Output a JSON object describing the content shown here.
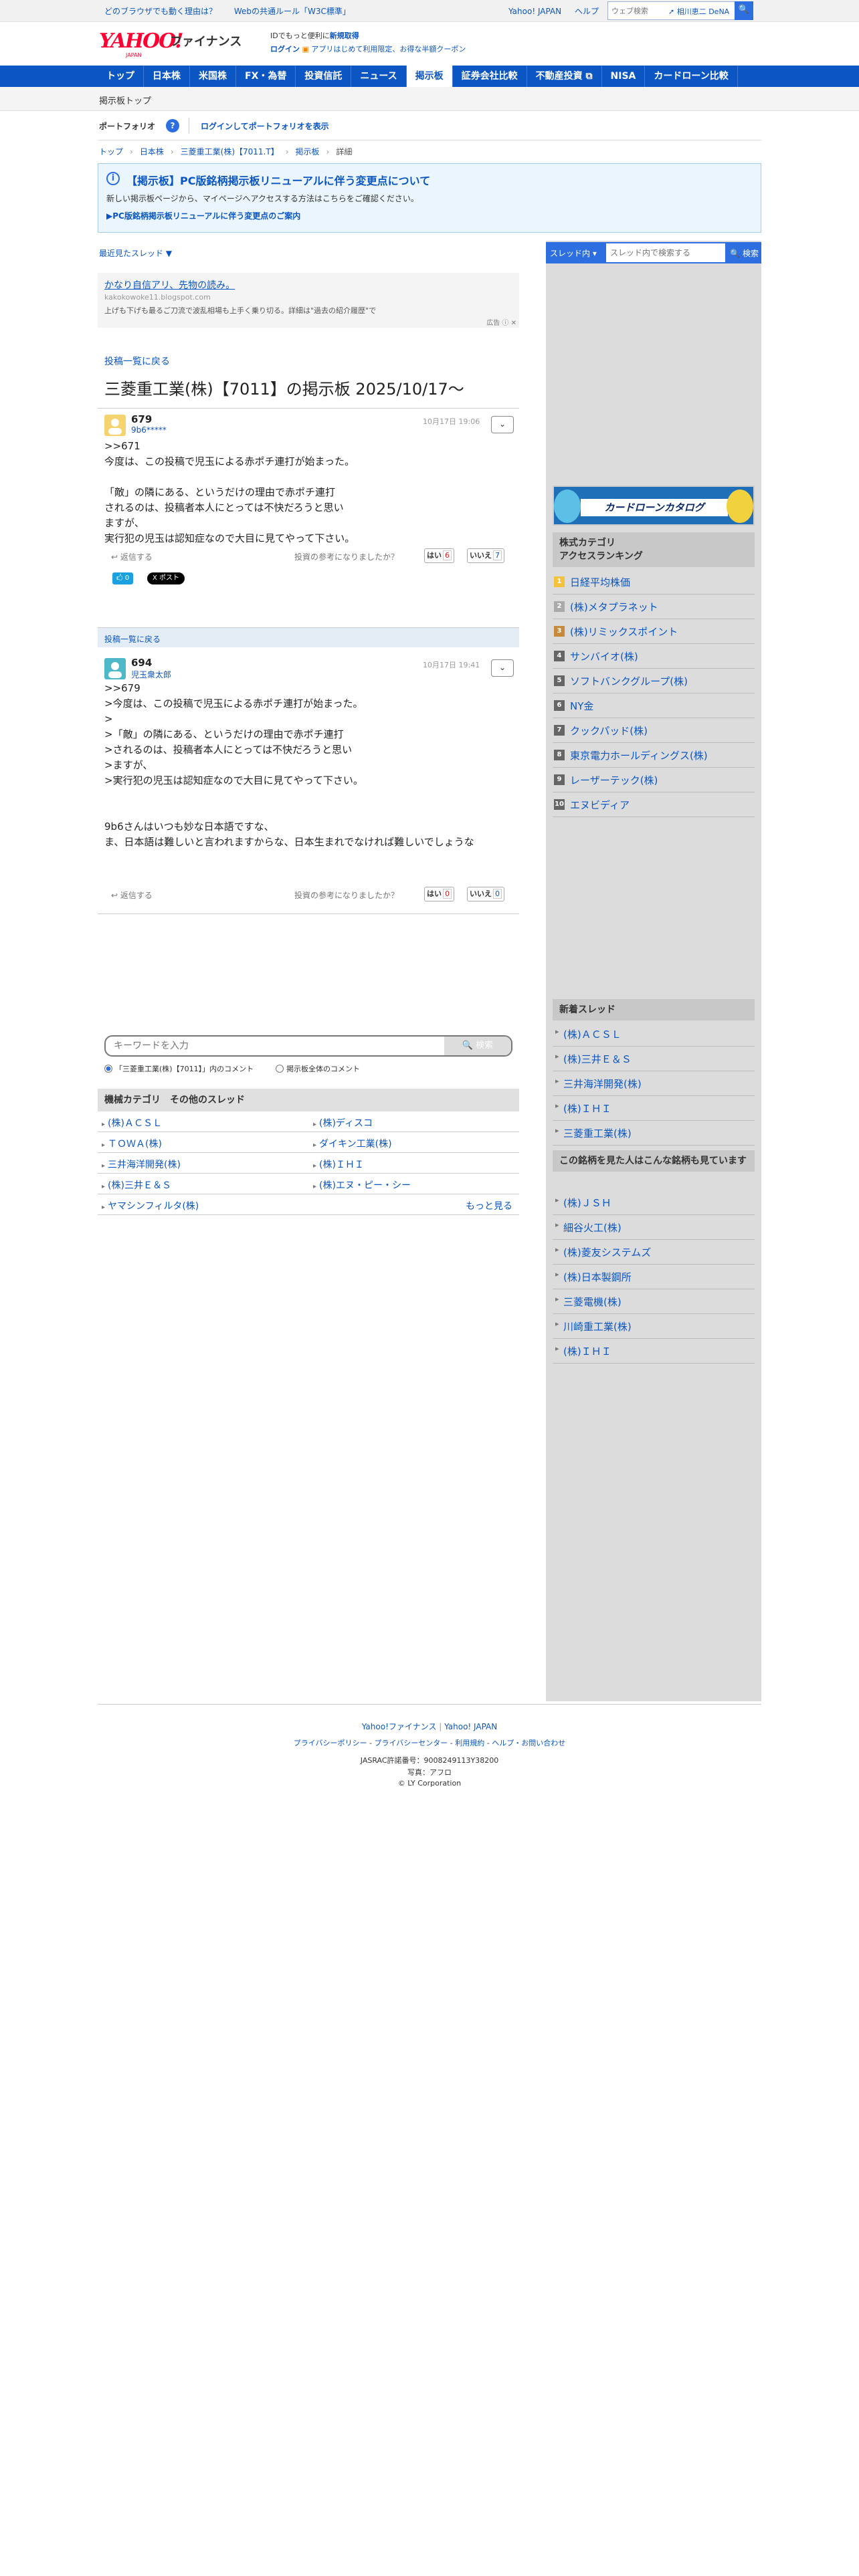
{
  "topbar": {
    "promo1": "どのブラウザでも動く理由は？",
    "promo2": "Webの共通ルール「W3C標準」",
    "yahoo_japan": "Yahoo! JAPAN",
    "help": "ヘルプ",
    "search_placeholder": "ウェブ検索",
    "user": "相川恵二 DeNA"
  },
  "header": {
    "logo": "YAHOO!",
    "logo_sub": "JAPAN",
    "service": "ファイナンス",
    "promo_line1": "IDでもっと便利に",
    "promo_signup": "新規取得",
    "login": "ログイン",
    "promo_line2": "アプリはじめて利用限定、お得な半額クーポン"
  },
  "nav": {
    "items": [
      "トップ",
      "日本株",
      "米国株",
      "FX・為替",
      "投資信託",
      "ニュース",
      "掲示板",
      "証券会社比較",
      "不動産投資",
      "NISA",
      "カードローン比較"
    ],
    "active": "掲示板"
  },
  "subnav": {
    "label": "掲示板トップ"
  },
  "portfolio": {
    "title": "ポートフォリオ",
    "help": "?",
    "login_link": "ログインしてポートフォリオを表示"
  },
  "breadcrumb": [
    "トップ",
    "日本株",
    "三菱重工業(株)【7011.T】",
    "掲示板",
    "詳細"
  ],
  "notice": {
    "icon": "i",
    "title": "【掲示板】PC版銘柄掲示板リニューアルに伴う変更点について",
    "desc": "新しい掲示板ページから、マイページへアクセスする方法はこちらをご確認ください。",
    "link": "▶PC版銘柄掲示板リニューアルに伴う変更点のご案内"
  },
  "main": {
    "recent_threads": "最近見たスレッド ▼",
    "ad": {
      "title": "かなり自信アリ、先物の読み。",
      "url": "kakokowoke11.blogspot.com",
      "desc": "上げも下げも最るご刀流で波乱相場も上手く乗り切る。詳細は\"過去の紹介履歴\"で",
      "mark": "広告 ⓘ ✕"
    },
    "back_to_list": "投稿一覧に戻る",
    "board_title": "三菱重工業(株)【7011】の掲示板 2025/10/17〜",
    "posts": [
      {
        "num": "679",
        "user": "9b6*****",
        "time": "10月17日 19:06",
        "body": ">>671\n今度は、この投稿で児玉による赤ポチ連打が始まった。\n\n「敵」の隣にある、というだけの理由で赤ポチ連打\nされるのは、投稿者本人にとっては不快だろうと思い\nますが、\n実行犯の児玉は認知症なので大目に見てやって下さい。",
        "reply": "返信する",
        "vote_q": "投資の参考になりましたか？",
        "yes": "はい",
        "yes_count": "6",
        "no": "いいえ",
        "no_count": "7",
        "share_fb": "🖒 0",
        "share_x": "X ポスト"
      },
      {
        "num": "694",
        "user": "児玉衆太郎",
        "time": "10月17日 19:41",
        "body": ">>679\n>今度は、この投稿で児玉による赤ポチ連打が始まった。\n>\n>「敵」の隣にある、というだけの理由で赤ポチ連打\n>されるのは、投稿者本人にとっては不快だろうと思い\n>ますが、\n>実行犯の児玉は認知症なので大目に見てやって下さい。\n\n\n9b6さんはいつも妙な日本語ですな、\nま、日本語は難しいと言われますからな、日本生まれでなければ難しいでしょうな",
        "reply": "返信する",
        "vote_q": "投資の参考になりましたか？",
        "yes": "はい",
        "yes_count": "0",
        "no": "いいえ",
        "no_count": "0"
      }
    ],
    "keyword_placeholder": "キーワードを入力",
    "search_button": "検索",
    "radio1": "「三菱重工業(株)【7011】」内のコメント",
    "radio2": "掲示板全体のコメント",
    "category": {
      "title": "機械カテゴリ　その他のスレッド",
      "left": [
        "(株)ＡＣＳＬ",
        "ＴＯＷＡ(株)",
        "三井海洋開発(株)",
        "(株)三井Ｅ＆Ｓ",
        "ヤマシンフィルタ(株)"
      ],
      "right": [
        "(株)ディスコ",
        "ダイキン工業(株)",
        "(株)ＩＨＩ",
        "(株)エヌ・ピー・シー"
      ],
      "more": "もっと見る"
    }
  },
  "side": {
    "search_dropdown": "スレッド内 ▾",
    "search_placeholder": "スレッド内で検索する",
    "search_button": "🔍 検索",
    "banner": "カードローンカタログ",
    "ranking_title": "株式カテゴリ\nアクセスランキング",
    "ranking": [
      "日経平均株価",
      "(株)メタプラネット",
      "(株)リミックスポイント",
      "サンバイオ(株)",
      "ソフトバンクグループ(株)",
      "NY金",
      "クックパッド(株)",
      "東京電力ホールディングス(株)",
      "レーザーテック(株)",
      "エヌビディア"
    ],
    "new_title": "新着スレッド",
    "new_threads": [
      "(株)ＡＣＳＬ",
      "(株)三井Ｅ＆Ｓ",
      "三井海洋開発(株)",
      "(株)ＩＨＩ",
      "三菱重工業(株)"
    ],
    "also_title": "この銘柄を見た人はこんな銘柄も見ています",
    "also": [
      "(株)ＪＳＨ",
      "細谷火工(株)",
      "(株)菱友システムズ",
      "(株)日本製鋼所",
      "三菱電機(株)",
      "川崎重工業(株)",
      "(株)ＩＨＩ"
    ]
  },
  "footer": {
    "l1a": "Yahoo!ファイナンス",
    "l1b": "Yahoo! JAPAN",
    "links": [
      "プライバシーポリシー",
      "プライバシーセンター",
      "利用規約",
      "ヘルプ・お問い合わせ"
    ],
    "jasrac": "JASRAC許諾番号：9008249113Y38200",
    "photo": "写真：アフロ",
    "copy": "© LY Corporation"
  }
}
